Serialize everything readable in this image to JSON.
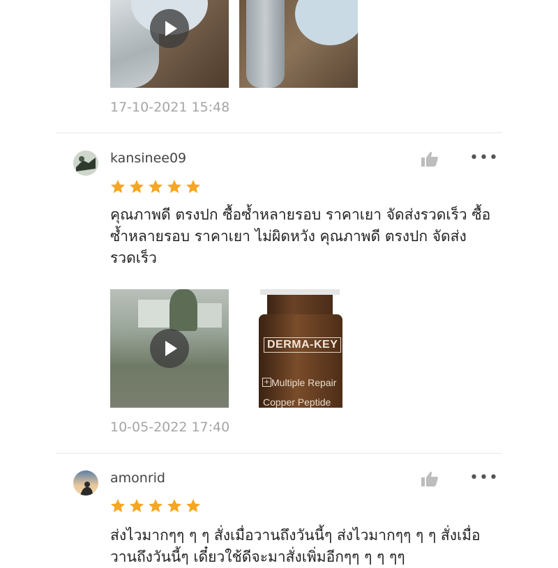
{
  "reviews": [
    {
      "date": "17-10-2021 15:48"
    },
    {
      "username": "kansinee09",
      "rating": 5,
      "text": "คุณภาพดี ตรงปก ซื้อซ้ำหลายรอบ ราคาเยา จัดส่งรวดเร็ว ซื้อซ้ำหลายรอบ ราคาเยา ไม่ผิดหวัง คุณภาพดี ตรงปก จัดส่งรวดเร็ว",
      "product_label": "DERMA-KEY",
      "product_line1": "Multiple Repair",
      "product_line2": "Copper Peptide",
      "date": "10-05-2022 17:40"
    },
    {
      "username": "amonrid",
      "rating": 5,
      "text": "ส่งไวมากๆๆ ๆ ๆ  สั่งเมื่อวานถึงวันนี้ๆ ส่งไวมากๆๆ ๆ ๆ สั่งเมื่อวานถึงวันนี้ๆ เดี๋ยวใช้ดีจะมาสั่งเพิ่มอีกๆๆ ๆ ๆ ๆๆ"
    }
  ],
  "icons": {
    "like": "thumbs-up-icon",
    "more": "more-dots-icon",
    "play": "play-icon",
    "star": "star-icon"
  },
  "colors": {
    "star": "#f5a623",
    "date": "#a5a5a5",
    "icon": "#bdbdbd"
  }
}
